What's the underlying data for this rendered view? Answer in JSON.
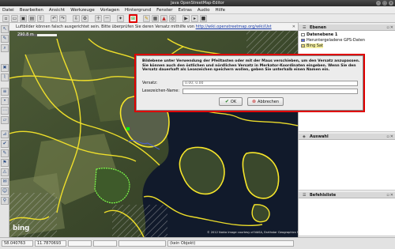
{
  "window": {
    "title": "Java OpenStreetMap-Editor",
    "controls": [
      "–",
      "□",
      "✕"
    ]
  },
  "menu": [
    "Datei",
    "Bearbeiten",
    "Ansicht",
    "Werkzeuge",
    "Vorlagen",
    "Hintergrund",
    "Fenster",
    "Extras",
    "Audio",
    "Hilfe"
  ],
  "toolbar": {
    "buttons": [
      {
        "name": "new-icon",
        "glyph": "▫"
      },
      {
        "name": "open-icon",
        "glyph": "📂"
      },
      {
        "name": "save-icon",
        "glyph": "▣"
      },
      {
        "name": "save-as-icon",
        "glyph": "▤"
      },
      {
        "name": "upload-icon",
        "glyph": "⇧"
      },
      {
        "name": "undo-icon",
        "glyph": "↶"
      },
      {
        "name": "redo-icon",
        "glyph": "↷"
      },
      {
        "name": "download-icon",
        "glyph": "⇩"
      },
      {
        "name": "preferences-icon",
        "glyph": "⚙"
      },
      {
        "name": "offset-icon",
        "glyph": "⊞"
      },
      {
        "name": "wrench-icon",
        "glyph": "✎"
      },
      {
        "name": "style-icon",
        "glyph": "▦"
      }
    ]
  },
  "map": {
    "info_text": "Luftbilder können falsch ausgerichtet sein. Bitte überprüfen Sie deren Versatz mithilfe von ",
    "info_link": "http://wiki.openstreetmap.org/wiki/Ust",
    "close_glyph": "✕",
    "scale_text": "290.8 m",
    "attribution_logo": "bing",
    "copyright": "© 2012 Nokia Image courtesy of NASA, Earthstar Geographics SIO © 2012 Microsoft Corporation Terms of Use"
  },
  "panels": {
    "layers": {
      "title": "Ebenen",
      "items": [
        {
          "label": "Datenebene 1",
          "color": "#ffffff",
          "bold": true
        },
        {
          "label": "Heruntergeladene GPS-Daten",
          "color": "#5d6fe0",
          "bold": false
        },
        {
          "label": "Bing Sat",
          "color": "#e7d36a",
          "bold": false
        }
      ]
    },
    "selection": {
      "title": "Auswahl"
    },
    "commands": {
      "title": "Befehlsliste"
    }
  },
  "status": {
    "lat": "58.040763",
    "lon": "11.7870693",
    "scale": "",
    "heading": "",
    "length": "",
    "selection": "(kein Objekt)"
  },
  "dialog": {
    "message": "Bildebene unter Verwendung der Pfeiltasten oder mit der Maus verschieben, um den Versatz anzupassen. Sie können auch den östlichen und nördlichen Versatz in Merkator-Koordinaten eingeben. Wenn Sie den Versatz dauerhaft als Lesezeichen speichern wollen, geben Sie unterhalb einen Namen ein.",
    "offset_label": "Versatz:",
    "offset_value": "0.00; 0.00",
    "bookmark_label": "Lesezeichen-Name:",
    "bookmark_value": "",
    "ok_label": "OK",
    "cancel_label": "Abbrechen"
  },
  "colors": {
    "highlight": "#e00000",
    "osm_way": "#f7e62a",
    "gps_track": "#4a5ee0"
  }
}
